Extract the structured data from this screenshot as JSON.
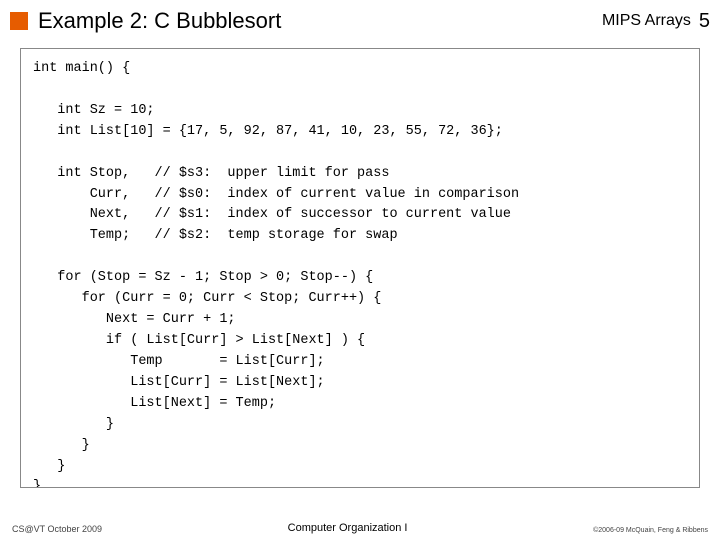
{
  "header": {
    "title": "Example 2: C Bubblesort",
    "rightLabel": "MIPS Arrays",
    "pageNum": "5"
  },
  "code": "int main() {\n\n   int Sz = 10;\n   int List[10] = {17, 5, 92, 87, 41, 10, 23, 55, 72, 36};\n\n   int Stop,   // $s3:  upper limit for pass\n       Curr,   // $s0:  index of current value in comparison\n       Next,   // $s1:  index of successor to current value\n       Temp;   // $s2:  temp storage for swap\n\n   for (Stop = Sz - 1; Stop > 0; Stop--) {\n      for (Curr = 0; Curr < Stop; Curr++) {\n         Next = Curr + 1;\n         if ( List[Curr] > List[Next] ) {\n            Temp       = List[Curr];\n            List[Curr] = List[Next];\n            List[Next] = Temp;\n         }\n      }\n   }\n}",
  "footer": {
    "left": "CS@VT October 2009",
    "center": "Computer Organization I",
    "right": "©2006-09  McQuain, Feng & Ribbens"
  }
}
